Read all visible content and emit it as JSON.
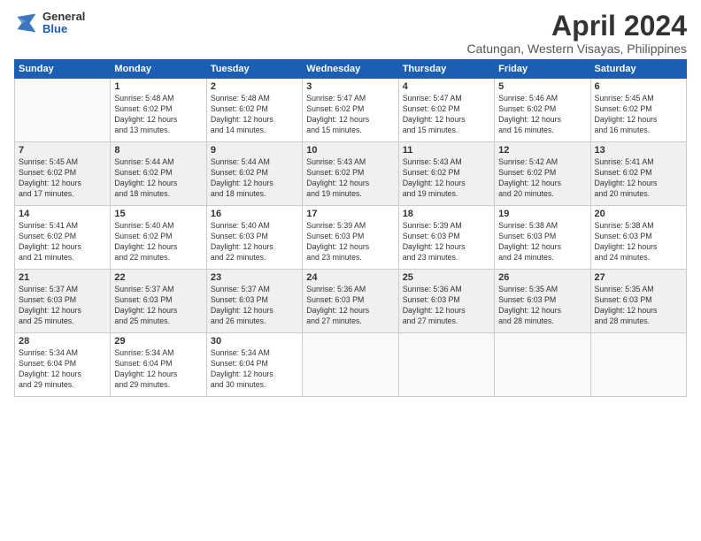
{
  "logo": {
    "general": "General",
    "blue": "Blue"
  },
  "title": "April 2024",
  "subtitle": "Catungan, Western Visayas, Philippines",
  "days_header": [
    "Sunday",
    "Monday",
    "Tuesday",
    "Wednesday",
    "Thursday",
    "Friday",
    "Saturday"
  ],
  "weeks": [
    [
      {
        "day": "",
        "info": ""
      },
      {
        "day": "1",
        "info": "Sunrise: 5:48 AM\nSunset: 6:02 PM\nDaylight: 12 hours\nand 13 minutes."
      },
      {
        "day": "2",
        "info": "Sunrise: 5:48 AM\nSunset: 6:02 PM\nDaylight: 12 hours\nand 14 minutes."
      },
      {
        "day": "3",
        "info": "Sunrise: 5:47 AM\nSunset: 6:02 PM\nDaylight: 12 hours\nand 15 minutes."
      },
      {
        "day": "4",
        "info": "Sunrise: 5:47 AM\nSunset: 6:02 PM\nDaylight: 12 hours\nand 15 minutes."
      },
      {
        "day": "5",
        "info": "Sunrise: 5:46 AM\nSunset: 6:02 PM\nDaylight: 12 hours\nand 16 minutes."
      },
      {
        "day": "6",
        "info": "Sunrise: 5:45 AM\nSunset: 6:02 PM\nDaylight: 12 hours\nand 16 minutes."
      }
    ],
    [
      {
        "day": "7",
        "info": "Sunrise: 5:45 AM\nSunset: 6:02 PM\nDaylight: 12 hours\nand 17 minutes."
      },
      {
        "day": "8",
        "info": "Sunrise: 5:44 AM\nSunset: 6:02 PM\nDaylight: 12 hours\nand 18 minutes."
      },
      {
        "day": "9",
        "info": "Sunrise: 5:44 AM\nSunset: 6:02 PM\nDaylight: 12 hours\nand 18 minutes."
      },
      {
        "day": "10",
        "info": "Sunrise: 5:43 AM\nSunset: 6:02 PM\nDaylight: 12 hours\nand 19 minutes."
      },
      {
        "day": "11",
        "info": "Sunrise: 5:43 AM\nSunset: 6:02 PM\nDaylight: 12 hours\nand 19 minutes."
      },
      {
        "day": "12",
        "info": "Sunrise: 5:42 AM\nSunset: 6:02 PM\nDaylight: 12 hours\nand 20 minutes."
      },
      {
        "day": "13",
        "info": "Sunrise: 5:41 AM\nSunset: 6:02 PM\nDaylight: 12 hours\nand 20 minutes."
      }
    ],
    [
      {
        "day": "14",
        "info": "Sunrise: 5:41 AM\nSunset: 6:02 PM\nDaylight: 12 hours\nand 21 minutes."
      },
      {
        "day": "15",
        "info": "Sunrise: 5:40 AM\nSunset: 6:02 PM\nDaylight: 12 hours\nand 22 minutes."
      },
      {
        "day": "16",
        "info": "Sunrise: 5:40 AM\nSunset: 6:03 PM\nDaylight: 12 hours\nand 22 minutes."
      },
      {
        "day": "17",
        "info": "Sunrise: 5:39 AM\nSunset: 6:03 PM\nDaylight: 12 hours\nand 23 minutes."
      },
      {
        "day": "18",
        "info": "Sunrise: 5:39 AM\nSunset: 6:03 PM\nDaylight: 12 hours\nand 23 minutes."
      },
      {
        "day": "19",
        "info": "Sunrise: 5:38 AM\nSunset: 6:03 PM\nDaylight: 12 hours\nand 24 minutes."
      },
      {
        "day": "20",
        "info": "Sunrise: 5:38 AM\nSunset: 6:03 PM\nDaylight: 12 hours\nand 24 minutes."
      }
    ],
    [
      {
        "day": "21",
        "info": "Sunrise: 5:37 AM\nSunset: 6:03 PM\nDaylight: 12 hours\nand 25 minutes."
      },
      {
        "day": "22",
        "info": "Sunrise: 5:37 AM\nSunset: 6:03 PM\nDaylight: 12 hours\nand 25 minutes."
      },
      {
        "day": "23",
        "info": "Sunrise: 5:37 AM\nSunset: 6:03 PM\nDaylight: 12 hours\nand 26 minutes."
      },
      {
        "day": "24",
        "info": "Sunrise: 5:36 AM\nSunset: 6:03 PM\nDaylight: 12 hours\nand 27 minutes."
      },
      {
        "day": "25",
        "info": "Sunrise: 5:36 AM\nSunset: 6:03 PM\nDaylight: 12 hours\nand 27 minutes."
      },
      {
        "day": "26",
        "info": "Sunrise: 5:35 AM\nSunset: 6:03 PM\nDaylight: 12 hours\nand 28 minutes."
      },
      {
        "day": "27",
        "info": "Sunrise: 5:35 AM\nSunset: 6:03 PM\nDaylight: 12 hours\nand 28 minutes."
      }
    ],
    [
      {
        "day": "28",
        "info": "Sunrise: 5:34 AM\nSunset: 6:04 PM\nDaylight: 12 hours\nand 29 minutes."
      },
      {
        "day": "29",
        "info": "Sunrise: 5:34 AM\nSunset: 6:04 PM\nDaylight: 12 hours\nand 29 minutes."
      },
      {
        "day": "30",
        "info": "Sunrise: 5:34 AM\nSunset: 6:04 PM\nDaylight: 12 hours\nand 30 minutes."
      },
      {
        "day": "",
        "info": ""
      },
      {
        "day": "",
        "info": ""
      },
      {
        "day": "",
        "info": ""
      },
      {
        "day": "",
        "info": ""
      }
    ]
  ]
}
